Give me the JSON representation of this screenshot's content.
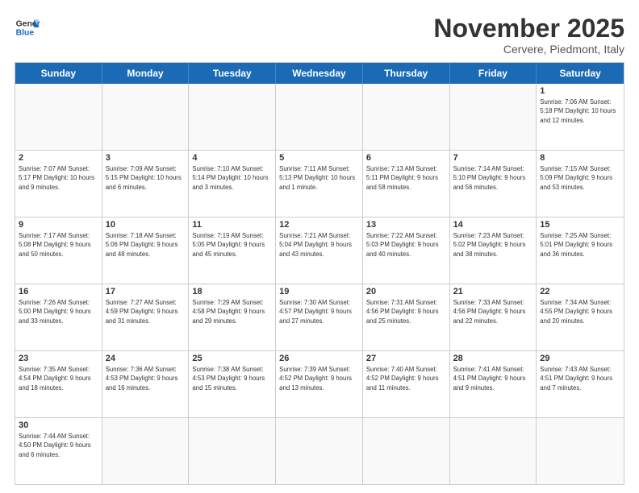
{
  "logo": {
    "text_general": "General",
    "text_blue": "Blue"
  },
  "title": "November 2025",
  "location": "Cervere, Piedmont, Italy",
  "day_names": [
    "Sunday",
    "Monday",
    "Tuesday",
    "Wednesday",
    "Thursday",
    "Friday",
    "Saturday"
  ],
  "rows": [
    [
      {
        "day": "",
        "info": ""
      },
      {
        "day": "",
        "info": ""
      },
      {
        "day": "",
        "info": ""
      },
      {
        "day": "",
        "info": ""
      },
      {
        "day": "",
        "info": ""
      },
      {
        "day": "",
        "info": ""
      },
      {
        "day": "1",
        "info": "Sunrise: 7:06 AM\nSunset: 5:18 PM\nDaylight: 10 hours and 12 minutes."
      }
    ],
    [
      {
        "day": "2",
        "info": "Sunrise: 7:07 AM\nSunset: 5:17 PM\nDaylight: 10 hours and 9 minutes."
      },
      {
        "day": "3",
        "info": "Sunrise: 7:09 AM\nSunset: 5:15 PM\nDaylight: 10 hours and 6 minutes."
      },
      {
        "day": "4",
        "info": "Sunrise: 7:10 AM\nSunset: 5:14 PM\nDaylight: 10 hours and 3 minutes."
      },
      {
        "day": "5",
        "info": "Sunrise: 7:11 AM\nSunset: 5:13 PM\nDaylight: 10 hours and 1 minute."
      },
      {
        "day": "6",
        "info": "Sunrise: 7:13 AM\nSunset: 5:11 PM\nDaylight: 9 hours and 58 minutes."
      },
      {
        "day": "7",
        "info": "Sunrise: 7:14 AM\nSunset: 5:10 PM\nDaylight: 9 hours and 56 minutes."
      },
      {
        "day": "8",
        "info": "Sunrise: 7:15 AM\nSunset: 5:09 PM\nDaylight: 9 hours and 53 minutes."
      }
    ],
    [
      {
        "day": "9",
        "info": "Sunrise: 7:17 AM\nSunset: 5:08 PM\nDaylight: 9 hours and 50 minutes."
      },
      {
        "day": "10",
        "info": "Sunrise: 7:18 AM\nSunset: 5:06 PM\nDaylight: 9 hours and 48 minutes."
      },
      {
        "day": "11",
        "info": "Sunrise: 7:19 AM\nSunset: 5:05 PM\nDaylight: 9 hours and 45 minutes."
      },
      {
        "day": "12",
        "info": "Sunrise: 7:21 AM\nSunset: 5:04 PM\nDaylight: 9 hours and 43 minutes."
      },
      {
        "day": "13",
        "info": "Sunrise: 7:22 AM\nSunset: 5:03 PM\nDaylight: 9 hours and 40 minutes."
      },
      {
        "day": "14",
        "info": "Sunrise: 7:23 AM\nSunset: 5:02 PM\nDaylight: 9 hours and 38 minutes."
      },
      {
        "day": "15",
        "info": "Sunrise: 7:25 AM\nSunset: 5:01 PM\nDaylight: 9 hours and 36 minutes."
      }
    ],
    [
      {
        "day": "16",
        "info": "Sunrise: 7:26 AM\nSunset: 5:00 PM\nDaylight: 9 hours and 33 minutes."
      },
      {
        "day": "17",
        "info": "Sunrise: 7:27 AM\nSunset: 4:59 PM\nDaylight: 9 hours and 31 minutes."
      },
      {
        "day": "18",
        "info": "Sunrise: 7:29 AM\nSunset: 4:58 PM\nDaylight: 9 hours and 29 minutes."
      },
      {
        "day": "19",
        "info": "Sunrise: 7:30 AM\nSunset: 4:57 PM\nDaylight: 9 hours and 27 minutes."
      },
      {
        "day": "20",
        "info": "Sunrise: 7:31 AM\nSunset: 4:56 PM\nDaylight: 9 hours and 25 minutes."
      },
      {
        "day": "21",
        "info": "Sunrise: 7:33 AM\nSunset: 4:56 PM\nDaylight: 9 hours and 22 minutes."
      },
      {
        "day": "22",
        "info": "Sunrise: 7:34 AM\nSunset: 4:55 PM\nDaylight: 9 hours and 20 minutes."
      }
    ],
    [
      {
        "day": "23",
        "info": "Sunrise: 7:35 AM\nSunset: 4:54 PM\nDaylight: 9 hours and 18 minutes."
      },
      {
        "day": "24",
        "info": "Sunrise: 7:36 AM\nSunset: 4:53 PM\nDaylight: 9 hours and 16 minutes."
      },
      {
        "day": "25",
        "info": "Sunrise: 7:38 AM\nSunset: 4:53 PM\nDaylight: 9 hours and 15 minutes."
      },
      {
        "day": "26",
        "info": "Sunrise: 7:39 AM\nSunset: 4:52 PM\nDaylight: 9 hours and 13 minutes."
      },
      {
        "day": "27",
        "info": "Sunrise: 7:40 AM\nSunset: 4:52 PM\nDaylight: 9 hours and 11 minutes."
      },
      {
        "day": "28",
        "info": "Sunrise: 7:41 AM\nSunset: 4:51 PM\nDaylight: 9 hours and 9 minutes."
      },
      {
        "day": "29",
        "info": "Sunrise: 7:43 AM\nSunset: 4:51 PM\nDaylight: 9 hours and 7 minutes."
      }
    ],
    [
      {
        "day": "30",
        "info": "Sunrise: 7:44 AM\nSunset: 4:50 PM\nDaylight: 9 hours and 6 minutes."
      },
      {
        "day": "",
        "info": ""
      },
      {
        "day": "",
        "info": ""
      },
      {
        "day": "",
        "info": ""
      },
      {
        "day": "",
        "info": ""
      },
      {
        "day": "",
        "info": ""
      },
      {
        "day": "",
        "info": ""
      }
    ]
  ]
}
